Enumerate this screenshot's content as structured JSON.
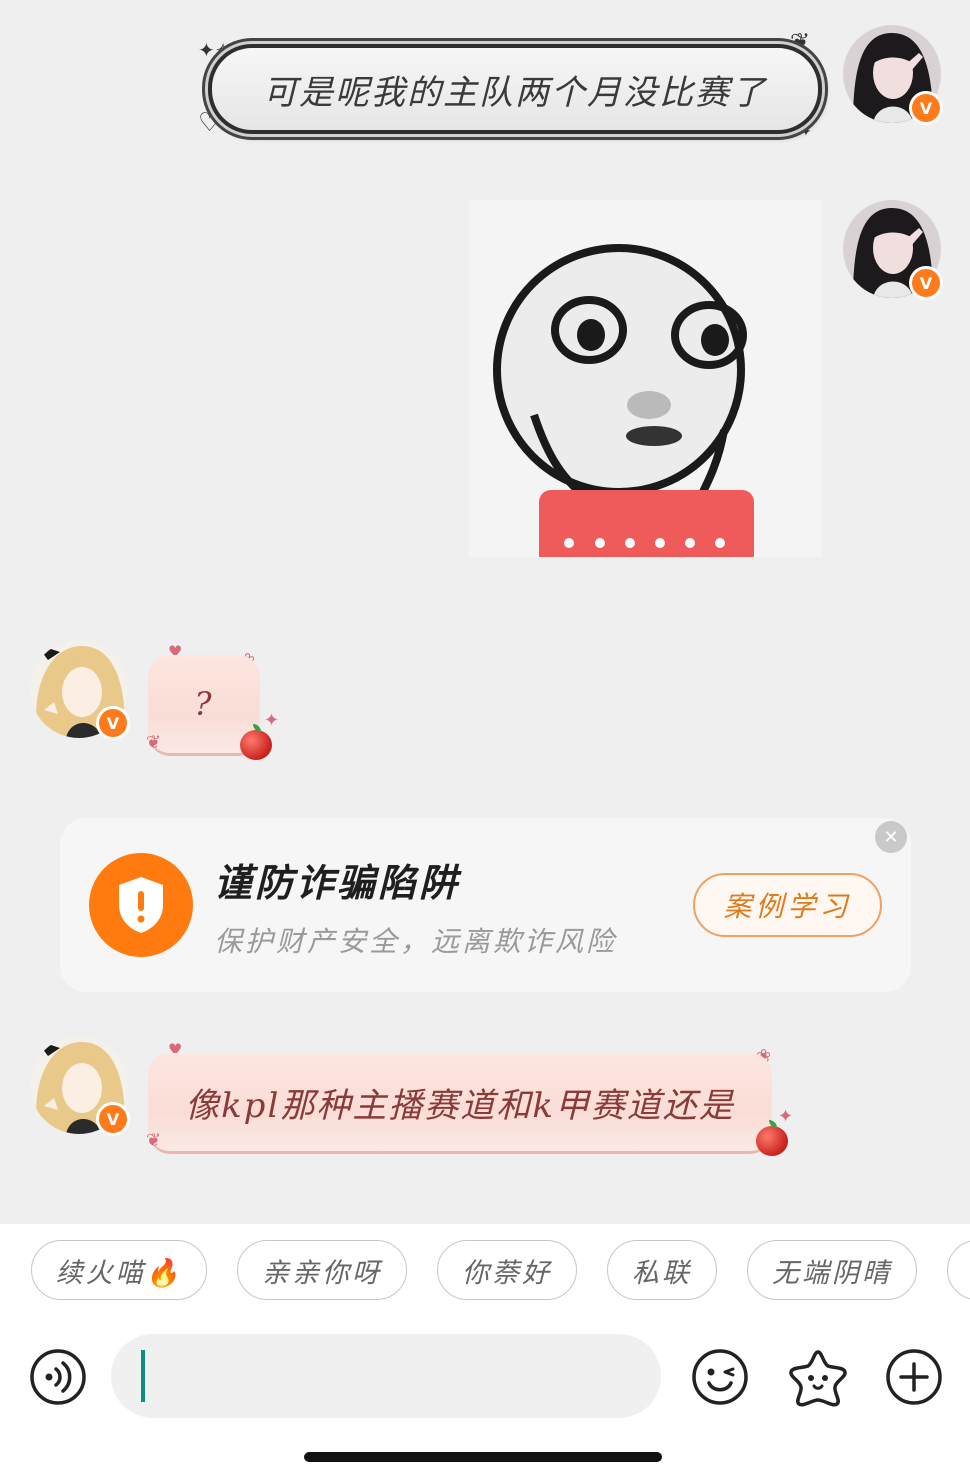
{
  "messages": {
    "outgoing_text": "可是呢我的主队两个月没比赛了",
    "incoming_question": "?",
    "incoming_text": "像kpl那种主播赛道和k甲赛道还是"
  },
  "badges": {
    "verified": "V"
  },
  "fraud_card": {
    "title": "谨防诈骗陷阱",
    "subtitle": "保护财产安全，远离欺诈风险",
    "button": "案例学习",
    "icon": "shield-alert-icon",
    "accent": "#ff7a0f"
  },
  "quick_replies": [
    "续火喵🔥",
    "亲亲你呀",
    "你萘好",
    "私联",
    "无端阴晴"
  ],
  "input_bar": {
    "placeholder": "",
    "voice_icon": "voice-icon",
    "emoji_icon": "emoji-icon",
    "sticker_icon": "star-sticker-icon",
    "add_icon": "plus-icon"
  },
  "colors": {
    "background": "#efefef",
    "incoming_bubble": "#fde6e0",
    "incoming_text": "#8b3a3a",
    "badge": "#ff7a1a"
  }
}
